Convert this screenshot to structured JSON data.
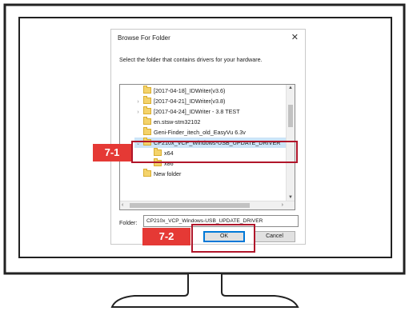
{
  "dialog": {
    "title": "Browse For Folder",
    "close_label": "✕",
    "instruction": "Select the folder that contains drivers for your hardware.",
    "tree_items": [
      {
        "label": "[2017-04-18]_IDWriter(v3.6)",
        "chevron": ""
      },
      {
        "label": "[2017-04-21]_IDWriter(v3.8)",
        "chevron": "›"
      },
      {
        "label": "[2017-04-24]_IDWriter - 3.8 TEST",
        "chevron": "›"
      },
      {
        "label": "en.stsw-stm32102",
        "chevron": ""
      },
      {
        "label": "Geni-Finder_itech_old_EasyVu 6.3v",
        "chevron": ""
      },
      {
        "label": "CP210x_VCP_Windows-USB_UPDATE_DRIVER",
        "chevron": "⌄",
        "selected": true
      },
      {
        "label": "x64",
        "chevron": ""
      },
      {
        "label": "x86",
        "chevron": ""
      },
      {
        "label": "New folder",
        "chevron": ""
      }
    ],
    "folder_label": "Folder:",
    "folder_value": "CP210x_VCP_Windows-USB_UPDATE_DRIVER",
    "ok_label": "OK",
    "cancel_label": "Cancel"
  },
  "callouts": {
    "step1": "7-1",
    "step2": "7-2"
  },
  "colors": {
    "callout_fill": "#e53935",
    "callout_frame": "#b0152a",
    "selection": "#cce4f7",
    "folder": "#f4d36b"
  }
}
